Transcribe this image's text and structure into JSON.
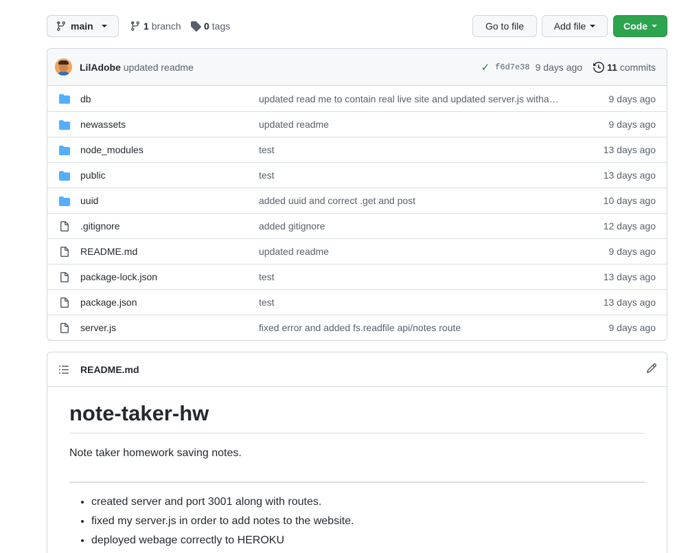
{
  "toolbar": {
    "branch_name": "main",
    "branch_count": "1",
    "branch_label": "branch",
    "tag_count": "0",
    "tag_label": "tags",
    "go_to_file": "Go to file",
    "add_file": "Add file",
    "code": "Code"
  },
  "commit": {
    "author": "LilAdobe",
    "message": "updated readme",
    "sha": "f6d7e38",
    "when": "9 days ago",
    "commit_count": "11",
    "commit_label": "commits"
  },
  "files": [
    {
      "name": "db",
      "type": "folder",
      "message": "updated read me to contain real live site and updated server.js witha…",
      "age": "9 days ago"
    },
    {
      "name": "newassets",
      "type": "folder",
      "message": "updated readme",
      "age": "9 days ago"
    },
    {
      "name": "node_modules",
      "type": "folder",
      "message": "test",
      "age": "13 days ago"
    },
    {
      "name": "public",
      "type": "folder",
      "message": "test",
      "age": "13 days ago"
    },
    {
      "name": "uuid",
      "type": "folder",
      "message": "added uuid and correct .get and post",
      "age": "10 days ago"
    },
    {
      "name": ".gitignore",
      "type": "file",
      "message": "added gitignore",
      "age": "12 days ago"
    },
    {
      "name": "README.md",
      "type": "file",
      "message": "updated readme",
      "age": "9 days ago"
    },
    {
      "name": "package-lock.json",
      "type": "file",
      "message": "test",
      "age": "13 days ago"
    },
    {
      "name": "package.json",
      "type": "file",
      "message": "test",
      "age": "13 days ago"
    },
    {
      "name": "server.js",
      "type": "file",
      "message": "fixed error and added fs.readfile api/notes route",
      "age": "9 days ago"
    }
  ],
  "readme": {
    "title": "README.md",
    "heading": "note-taker-hw",
    "description": "Note taker homework saving notes.",
    "bullets": [
      "created server and port 3001 along with routes.",
      "fixed my server.js in order to add notes to the website.",
      "deployed webage correctly to HEROKU"
    ]
  },
  "colors": {
    "folder_icon": "#54aeff",
    "code_button": "#2da44e",
    "check": "#1a7f37"
  }
}
